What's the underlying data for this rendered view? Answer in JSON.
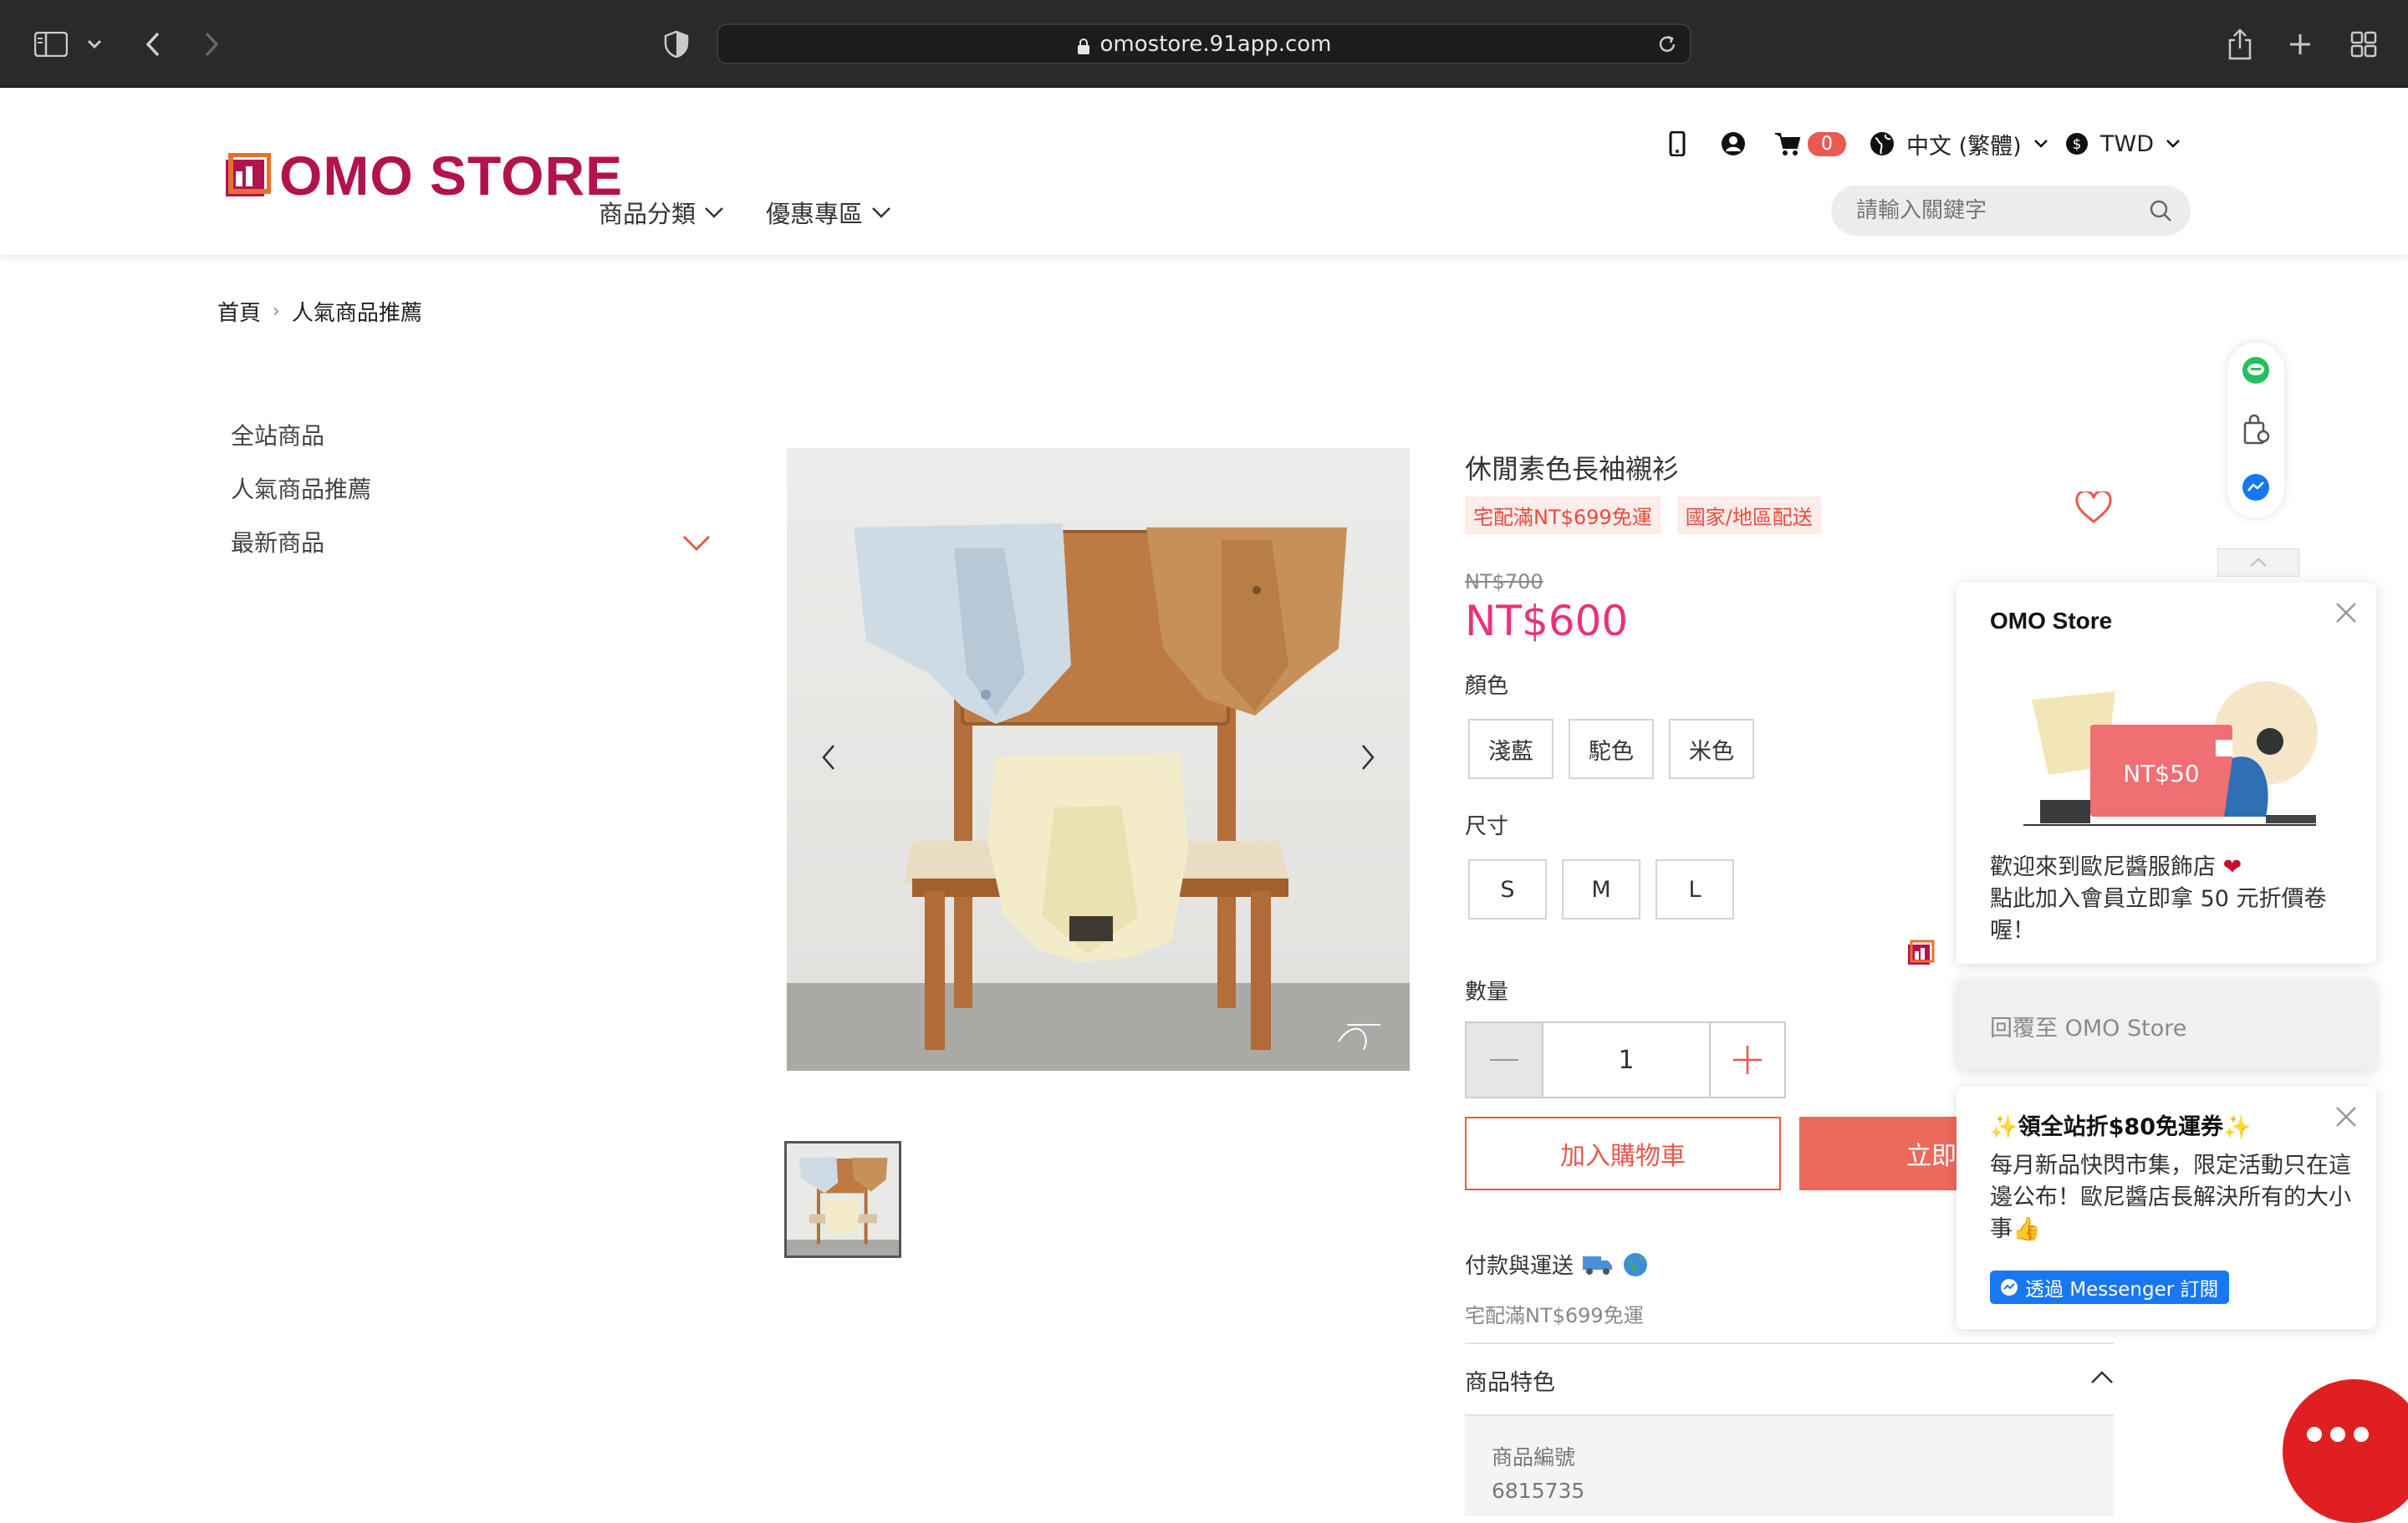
{
  "browser": {
    "url": "omostore.91app.com"
  },
  "header": {
    "logo_text": "OMO STORE",
    "nav": [
      {
        "label": "商品分類"
      },
      {
        "label": "優惠專區"
      }
    ],
    "cart_count": "0",
    "language": "中文 (繁體)",
    "currency": "TWD",
    "search_placeholder": "請輸入關鍵字"
  },
  "breadcrumb": {
    "home": "首頁",
    "current": "人氣商品推薦"
  },
  "sidebar": {
    "items": [
      {
        "label": "全站商品"
      },
      {
        "label": "人氣商品推薦"
      },
      {
        "label": "最新商品"
      }
    ]
  },
  "product": {
    "title": "休閒素色長袖襯衫",
    "tags": [
      "宅配滿NT$699免運",
      "國家/地區配送"
    ],
    "old_price": "NT$700",
    "price": "NT$600",
    "color_label": "顏色",
    "colors": [
      "淺藍",
      "駝色",
      "米色"
    ],
    "size_label": "尺寸",
    "sizes": [
      "S",
      "M",
      "L"
    ],
    "qty_label": "數量",
    "qty_value": "1",
    "add_to_cart": "加入購物車",
    "buy_now": "立即",
    "shipping_title": "付款與運送",
    "shipping_note": "宅配滿NT$699免運",
    "features_title": "商品特色",
    "sku_label": "商品編號",
    "sku_value": "6815735"
  },
  "chat": {
    "store_name": "OMO Store",
    "promo_text": "NT$50",
    "welcome_line1": "歡迎來到歐尼醬服飾店",
    "welcome_line2": "點此加入會員立即拿 50 元折價卷喔！",
    "reply_placeholder": "回覆至 OMO Store",
    "coupon_title": "領全站折$80免運券",
    "coupon_body": "每月新品快閃市集，限定活動只在這邊公布！歐尼醬店長解決所有的大小事",
    "subscribe_label": "透過 Messenger 訂閱"
  },
  "colors": {
    "brand": "#b2134d",
    "price": "#e8327b",
    "accent": "#e8574d",
    "messenger": "#1877f2",
    "chat_button": "#e02020"
  }
}
